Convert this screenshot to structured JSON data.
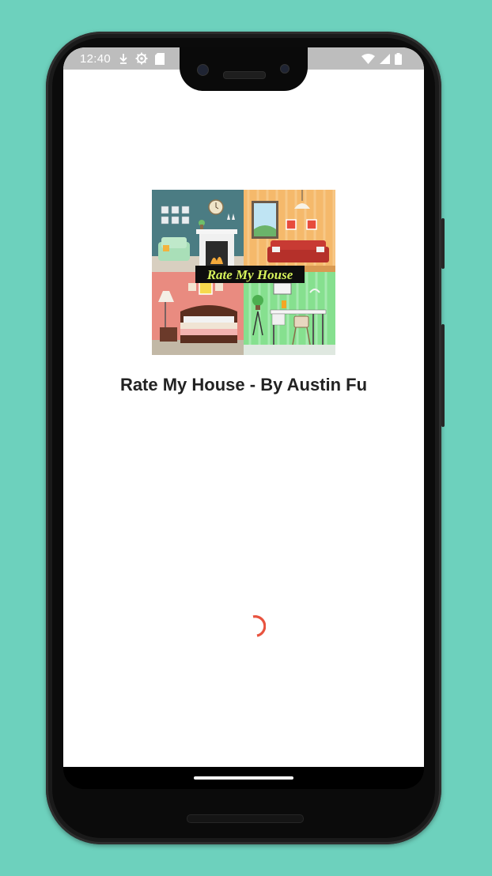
{
  "status_bar": {
    "time": "12:40",
    "left_icons": [
      "download-icon",
      "settings-icon",
      "sd-card-icon"
    ],
    "right_icons": [
      "wifi-icon",
      "cellular-signal-icon",
      "battery-icon"
    ]
  },
  "splash": {
    "logo_text": "Rate My House",
    "title": "Rate My House - By Austin Fu"
  },
  "loading": {
    "indicator": "spinner-icon",
    "color": "#e8533f"
  },
  "colors": {
    "background": "#6dd1bd",
    "accent": "#e8533f"
  }
}
